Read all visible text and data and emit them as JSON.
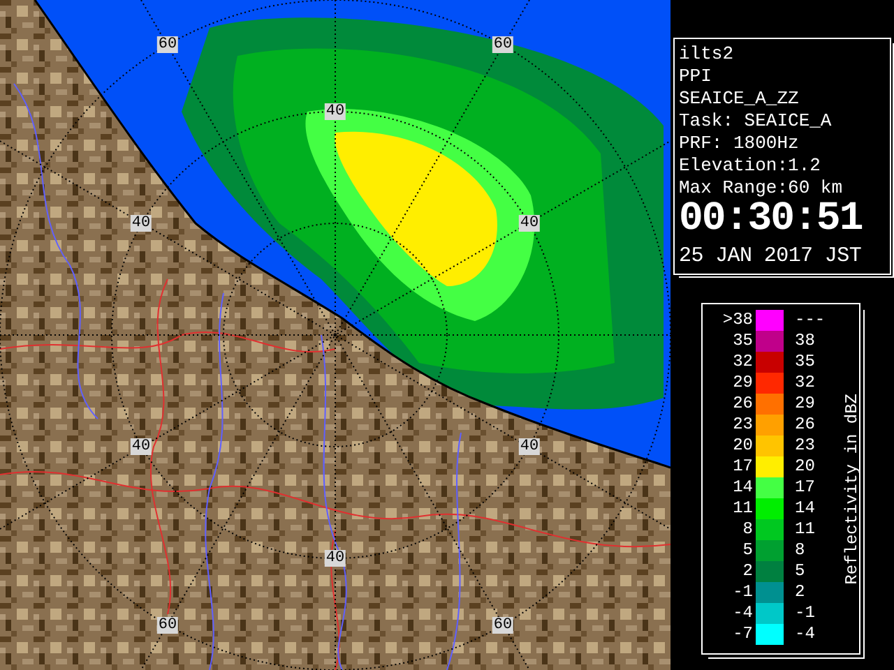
{
  "radar_map": {
    "range_labels": [
      "60",
      "60",
      "40",
      "40",
      "40",
      "40",
      "40",
      "40",
      "60",
      "60"
    ]
  },
  "info_panel": {
    "lines": [
      "ilts2",
      "PPI",
      "SEAICE_A_ZZ",
      "Task: SEAICE_A",
      "PRF: 1800Hz",
      "Elevation:1.2",
      "Max Range:60 km"
    ],
    "time": "00:30:51",
    "date": "25 JAN 2017 JST"
  },
  "legend": {
    "title": "Reflectivity in dBZ",
    "rows": [
      {
        "low": ">38",
        "high": "---",
        "color": "#ff00ff"
      },
      {
        "low": "35",
        "high": "38",
        "color": "#c0008a"
      },
      {
        "low": "32",
        "high": "35",
        "color": "#c80000"
      },
      {
        "low": "29",
        "high": "32",
        "color": "#ff2800"
      },
      {
        "low": "26",
        "high": "29",
        "color": "#ff7000"
      },
      {
        "low": "23",
        "high": "26",
        "color": "#ffa000"
      },
      {
        "low": "20",
        "high": "23",
        "color": "#ffc400"
      },
      {
        "low": "17",
        "high": "20",
        "color": "#ffee00"
      },
      {
        "low": "14",
        "high": "17",
        "color": "#44ff44"
      },
      {
        "low": "11",
        "high": "14",
        "color": "#00ee00"
      },
      {
        "low": "8",
        "high": "11",
        "color": "#00c820"
      },
      {
        "low": "5",
        "high": "8",
        "color": "#00a030"
      },
      {
        "low": "2",
        "high": "5",
        "color": "#008040"
      },
      {
        "low": "-1",
        "high": "2",
        "color": "#009090"
      },
      {
        "low": "-4",
        "high": "-1",
        "color": "#00c8c8"
      },
      {
        "low": "-7",
        "high": "-4",
        "color": "#00ffff"
      }
    ]
  }
}
